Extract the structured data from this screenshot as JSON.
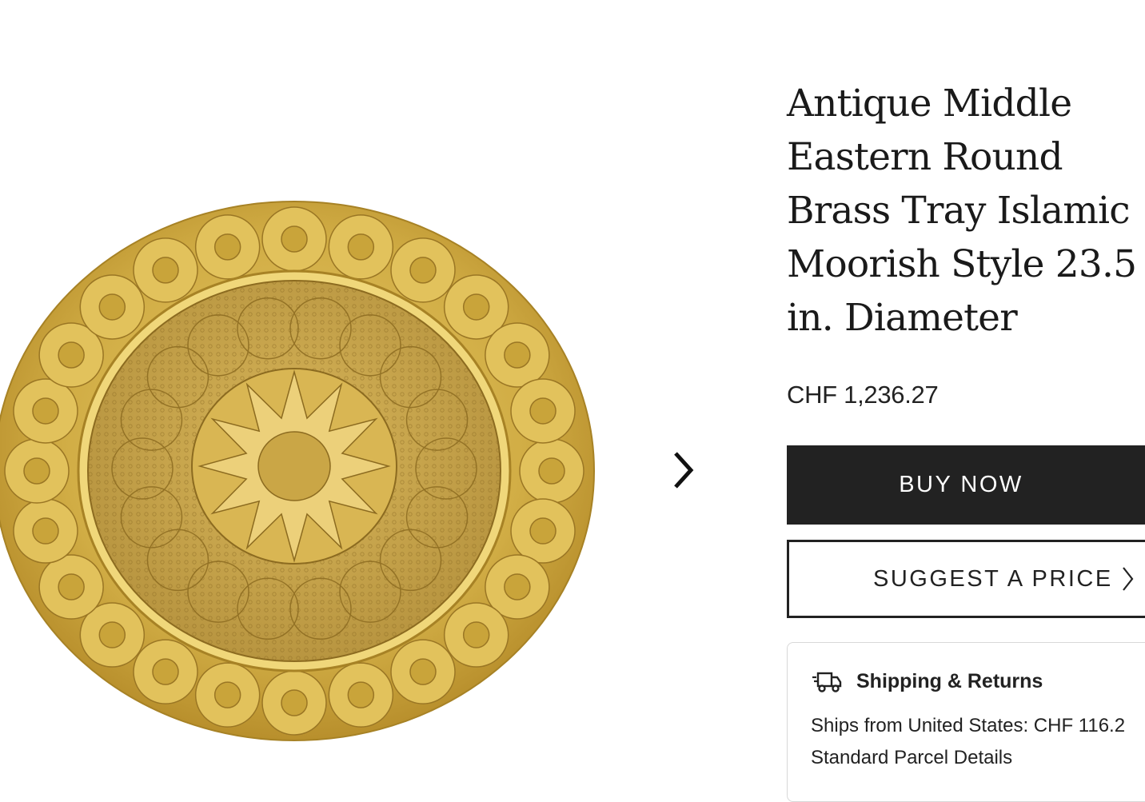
{
  "product": {
    "title": "Antique Middle Eastern Round Brass Tray Islamic Moorish Style 23.5 in. Diameter",
    "price": "CHF 1,236.27",
    "image_icon": "brass-tray-image"
  },
  "actions": {
    "buy_now_label": "BUY NOW",
    "suggest_price_label": "SUGGEST A PRICE"
  },
  "gallery": {
    "next_icon": "chevron-right-icon"
  },
  "shipping": {
    "title": "Shipping & Returns",
    "ships_from": "Ships from United States: CHF 116.2",
    "parcel_details": "Standard Parcel Details",
    "icon": "truck-icon"
  },
  "colors": {
    "primary_button": "#222222",
    "brass": "#c9a43a"
  }
}
